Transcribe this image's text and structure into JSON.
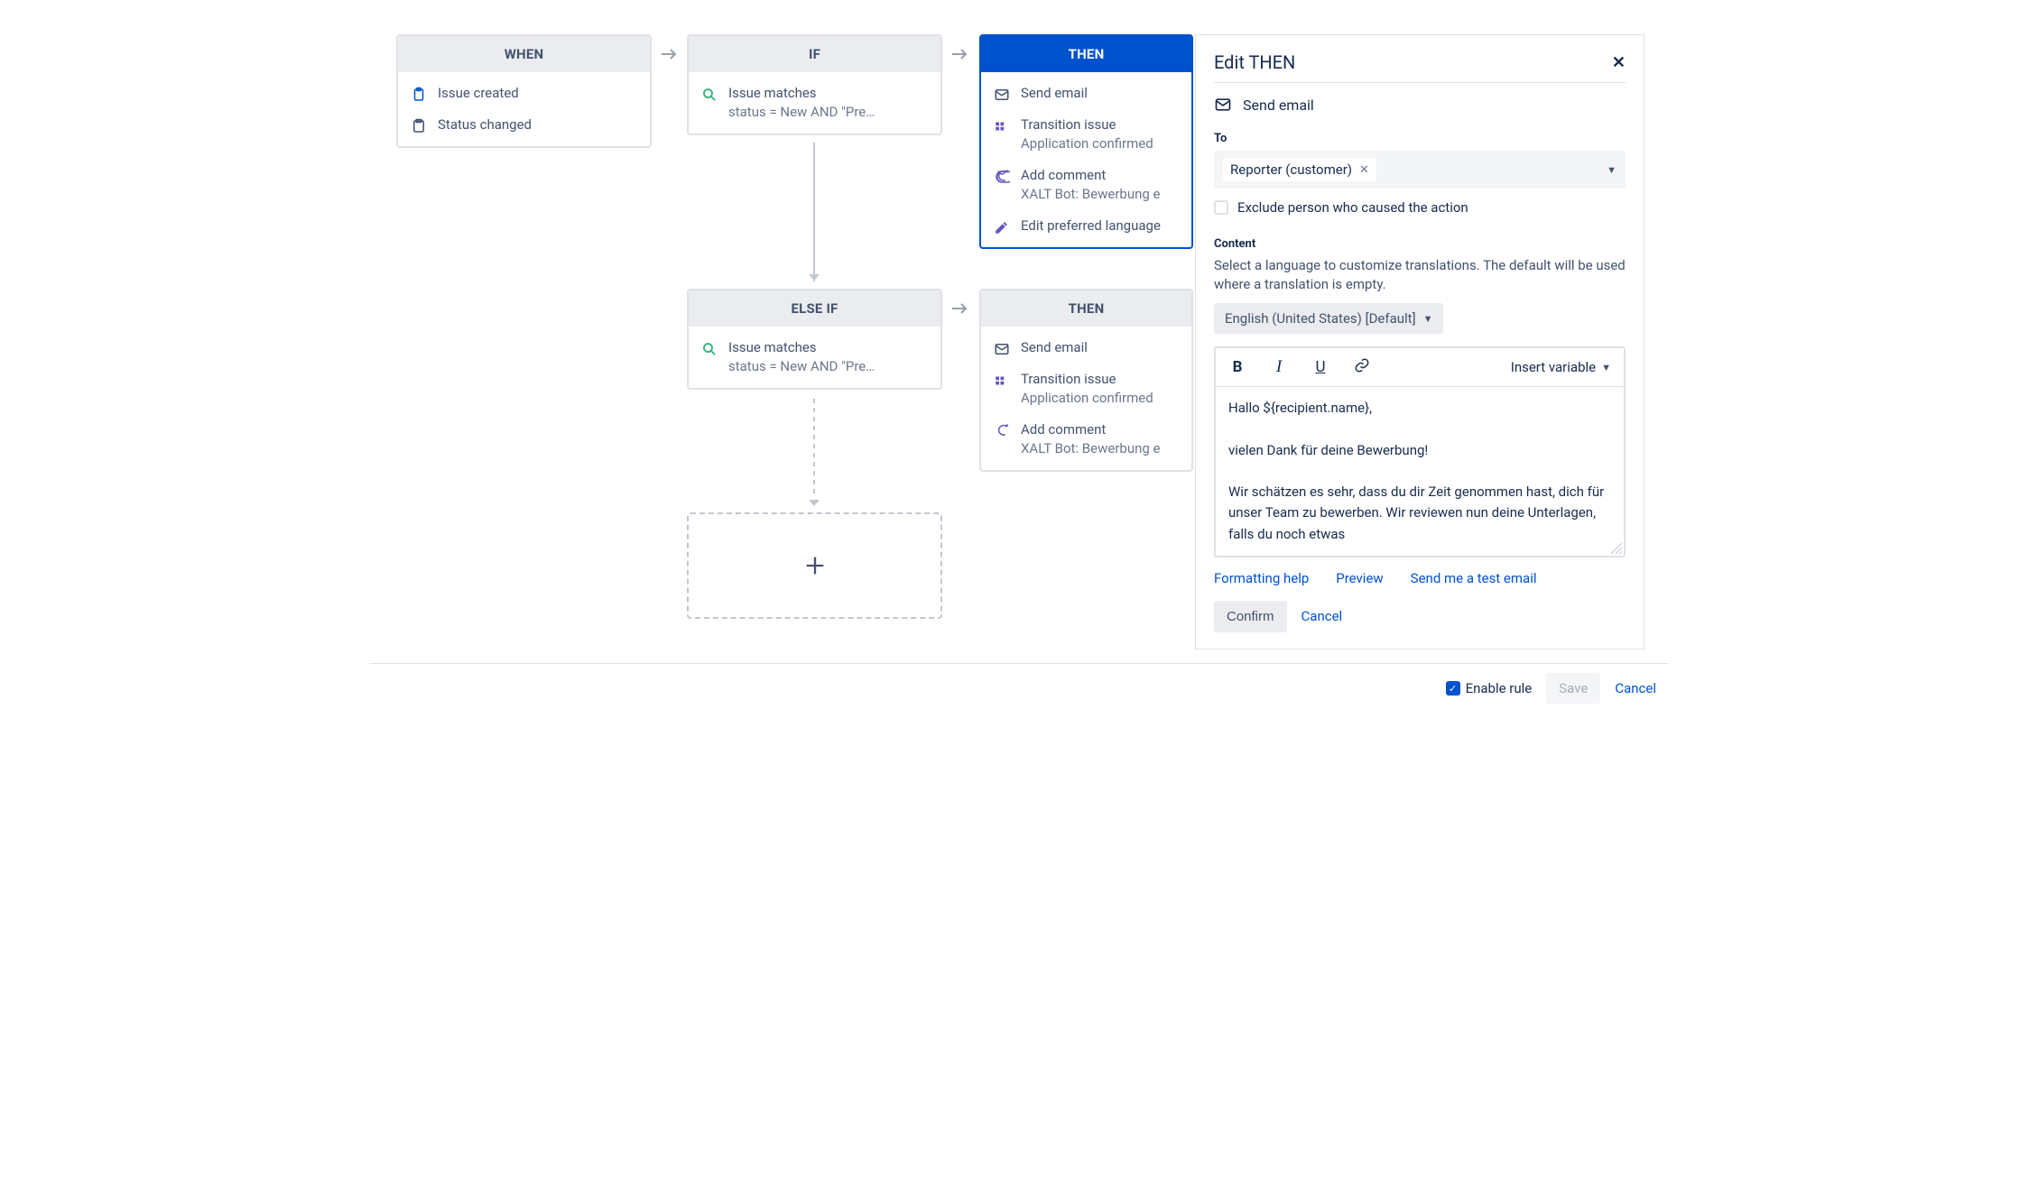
{
  "when": {
    "header": "WHEN",
    "items": [
      {
        "icon": "clipboard-icon",
        "label": "Issue created"
      },
      {
        "icon": "status-icon",
        "label": "Status changed"
      }
    ]
  },
  "if": {
    "header": "IF",
    "condition_label": "Issue matches",
    "condition_sub": "status = New AND \"Pre…"
  },
  "then1": {
    "header": "THEN",
    "actions": [
      {
        "icon": "mail-icon",
        "label": "Send email",
        "sub": ""
      },
      {
        "icon": "transition-icon",
        "label": "Transition issue",
        "sub": "Application confirmed"
      },
      {
        "icon": "comment-icon",
        "label": "Add comment",
        "sub": "XALT Bot: Bewerbung e"
      },
      {
        "icon": "edit-icon",
        "label": "Edit preferred language",
        "sub": ""
      }
    ]
  },
  "elseif": {
    "header": "ELSE IF",
    "condition_label": "Issue matches",
    "condition_sub": "status = New AND \"Pre…"
  },
  "then2": {
    "header": "THEN",
    "actions": [
      {
        "icon": "mail-icon",
        "label": "Send email",
        "sub": ""
      },
      {
        "icon": "transition-icon",
        "label": "Transition issue",
        "sub": "Application confirmed"
      },
      {
        "icon": "comment-icon",
        "label": "Add comment",
        "sub": "XALT Bot: Bewerbung e"
      }
    ]
  },
  "panel": {
    "title": "Edit THEN",
    "action_label": "Send email",
    "to_label": "To",
    "to_chip": "Reporter (customer)",
    "exclude_label": "Exclude person who caused the action",
    "content_label": "Content",
    "content_hint": "Select a language to customize translations. The default will be used where a translation is empty.",
    "language": "English (United States) [Default]",
    "insert_variable": "Insert variable",
    "body": "Hallo ${recipient.name},\n\nvielen Dank für deine Bewerbung!\n\nWir schätzen es sehr, dass du dir Zeit genommen hast, dich für unser Team zu bewerben. Wir reviewen nun deine Unterlagen, falls du noch etwas",
    "links": {
      "formatting": "Formatting help",
      "preview": "Preview",
      "test": "Send me a test email"
    },
    "confirm": "Confirm",
    "cancel": "Cancel"
  },
  "footer": {
    "enable": "Enable rule",
    "save": "Save",
    "cancel": "Cancel"
  }
}
